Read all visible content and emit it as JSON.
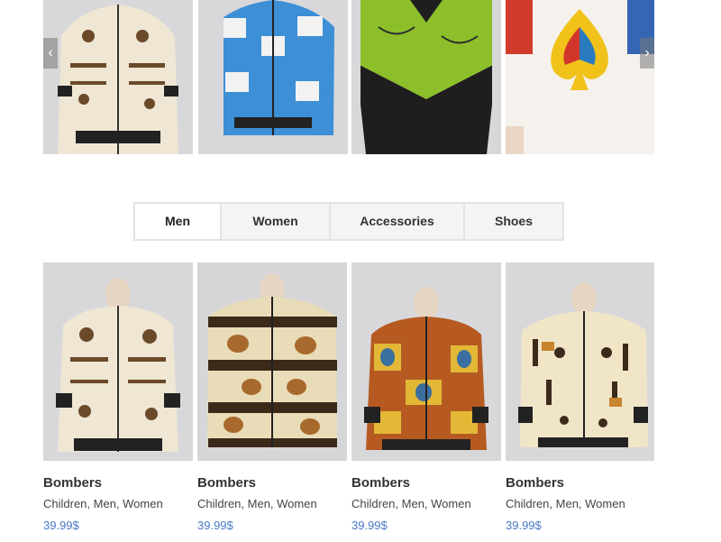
{
  "carousel": {
    "prev_icon": "chevron-left-icon",
    "next_icon": "chevron-right-icon",
    "prev_glyph": "‹",
    "next_glyph": "›"
  },
  "tabs": [
    {
      "label": "Men",
      "active": true
    },
    {
      "label": "Women",
      "active": false
    },
    {
      "label": "Accessories",
      "active": false
    },
    {
      "label": "Shoes",
      "active": false
    }
  ],
  "products": [
    {
      "name": "Bombers",
      "categories": "Children, Men, Women",
      "price": "39.99$"
    },
    {
      "name": "Bombers",
      "categories": "Children, Men, Women",
      "price": "39.99$"
    },
    {
      "name": "Bombers",
      "categories": "Children, Men, Women",
      "price": "39.99$"
    },
    {
      "name": "Bombers",
      "categories": "Children, Men, Women",
      "price": "39.99$"
    }
  ],
  "colors": {
    "price": "#4a78c8",
    "tab_border": "#e3e3e3"
  }
}
